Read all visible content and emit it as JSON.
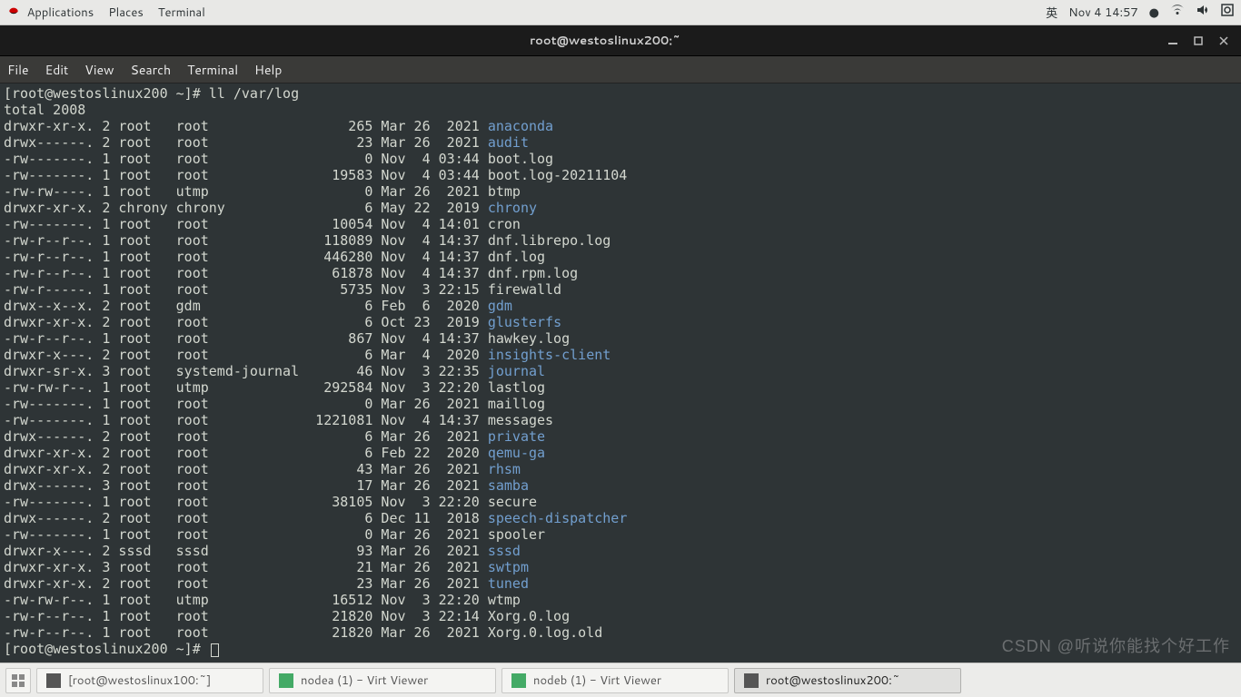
{
  "topbar": {
    "apps": "Applications",
    "places": "Places",
    "terminal": "Terminal",
    "lang": "英",
    "clock": "Nov 4  14:57",
    "dot": "●"
  },
  "window": {
    "title": "root@westoslinux200:~"
  },
  "menu": {
    "file": "File",
    "edit": "Edit",
    "view": "View",
    "search": "Search",
    "terminal": "Terminal",
    "help": "Help"
  },
  "prompt1": "[root@westoslinux200 ~]# ll /var/log",
  "total": "total 2008",
  "rows": [
    {
      "perm": "drwxr-xr-x.",
      "n": "2",
      "u": "root  ",
      "g": "root           ",
      "sz": "     265",
      "dt": "Mar 26  2021",
      "name": "anaconda",
      "dir": true
    },
    {
      "perm": "drwx------.",
      "n": "2",
      "u": "root  ",
      "g": "root           ",
      "sz": "      23",
      "dt": "Mar 26  2021",
      "name": "audit",
      "dir": true
    },
    {
      "perm": "-rw-------.",
      "n": "1",
      "u": "root  ",
      "g": "root           ",
      "sz": "       0",
      "dt": "Nov  4 03:44",
      "name": "boot.log",
      "dir": false
    },
    {
      "perm": "-rw-------.",
      "n": "1",
      "u": "root  ",
      "g": "root           ",
      "sz": "   19583",
      "dt": "Nov  4 03:44",
      "name": "boot.log-20211104",
      "dir": false
    },
    {
      "perm": "-rw-rw----.",
      "n": "1",
      "u": "root  ",
      "g": "utmp           ",
      "sz": "       0",
      "dt": "Mar 26  2021",
      "name": "btmp",
      "dir": false
    },
    {
      "perm": "drwxr-xr-x.",
      "n": "2",
      "u": "chrony",
      "g": "chrony         ",
      "sz": "       6",
      "dt": "May 22  2019",
      "name": "chrony",
      "dir": true
    },
    {
      "perm": "-rw-------.",
      "n": "1",
      "u": "root  ",
      "g": "root           ",
      "sz": "   10054",
      "dt": "Nov  4 14:01",
      "name": "cron",
      "dir": false
    },
    {
      "perm": "-rw-r--r--.",
      "n": "1",
      "u": "root  ",
      "g": "root           ",
      "sz": "  118089",
      "dt": "Nov  4 14:37",
      "name": "dnf.librepo.log",
      "dir": false
    },
    {
      "perm": "-rw-r--r--.",
      "n": "1",
      "u": "root  ",
      "g": "root           ",
      "sz": "  446280",
      "dt": "Nov  4 14:37",
      "name": "dnf.log",
      "dir": false
    },
    {
      "perm": "-rw-r--r--.",
      "n": "1",
      "u": "root  ",
      "g": "root           ",
      "sz": "   61878",
      "dt": "Nov  4 14:37",
      "name": "dnf.rpm.log",
      "dir": false
    },
    {
      "perm": "-rw-r-----.",
      "n": "1",
      "u": "root  ",
      "g": "root           ",
      "sz": "    5735",
      "dt": "Nov  3 22:15",
      "name": "firewalld",
      "dir": false
    },
    {
      "perm": "drwx--x--x.",
      "n": "2",
      "u": "root  ",
      "g": "gdm            ",
      "sz": "       6",
      "dt": "Feb  6  2020",
      "name": "gdm",
      "dir": true
    },
    {
      "perm": "drwxr-xr-x.",
      "n": "2",
      "u": "root  ",
      "g": "root           ",
      "sz": "       6",
      "dt": "Oct 23  2019",
      "name": "glusterfs",
      "dir": true
    },
    {
      "perm": "-rw-r--r--.",
      "n": "1",
      "u": "root  ",
      "g": "root           ",
      "sz": "     867",
      "dt": "Nov  4 14:37",
      "name": "hawkey.log",
      "dir": false
    },
    {
      "perm": "drwxr-x---.",
      "n": "2",
      "u": "root  ",
      "g": "root           ",
      "sz": "       6",
      "dt": "Mar  4  2020",
      "name": "insights-client",
      "dir": true
    },
    {
      "perm": "drwxr-sr-x.",
      "n": "3",
      "u": "root  ",
      "g": "systemd-journal",
      "sz": "      46",
      "dt": "Nov  3 22:35",
      "name": "journal",
      "dir": true
    },
    {
      "perm": "-rw-rw-r--.",
      "n": "1",
      "u": "root  ",
      "g": "utmp           ",
      "sz": "  292584",
      "dt": "Nov  3 22:20",
      "name": "lastlog",
      "dir": false
    },
    {
      "perm": "-rw-------.",
      "n": "1",
      "u": "root  ",
      "g": "root           ",
      "sz": "       0",
      "dt": "Mar 26  2021",
      "name": "maillog",
      "dir": false
    },
    {
      "perm": "-rw-------.",
      "n": "1",
      "u": "root  ",
      "g": "root           ",
      "sz": " 1221081",
      "dt": "Nov  4 14:37",
      "name": "messages",
      "dir": false
    },
    {
      "perm": "drwx------.",
      "n": "2",
      "u": "root  ",
      "g": "root           ",
      "sz": "       6",
      "dt": "Mar 26  2021",
      "name": "private",
      "dir": true
    },
    {
      "perm": "drwxr-xr-x.",
      "n": "2",
      "u": "root  ",
      "g": "root           ",
      "sz": "       6",
      "dt": "Feb 22  2020",
      "name": "qemu-ga",
      "dir": true
    },
    {
      "perm": "drwxr-xr-x.",
      "n": "2",
      "u": "root  ",
      "g": "root           ",
      "sz": "      43",
      "dt": "Mar 26  2021",
      "name": "rhsm",
      "dir": true
    },
    {
      "perm": "drwx------.",
      "n": "3",
      "u": "root  ",
      "g": "root           ",
      "sz": "      17",
      "dt": "Mar 26  2021",
      "name": "samba",
      "dir": true
    },
    {
      "perm": "-rw-------.",
      "n": "1",
      "u": "root  ",
      "g": "root           ",
      "sz": "   38105",
      "dt": "Nov  3 22:20",
      "name": "secure",
      "dir": false
    },
    {
      "perm": "drwx------.",
      "n": "2",
      "u": "root  ",
      "g": "root           ",
      "sz": "       6",
      "dt": "Dec 11  2018",
      "name": "speech-dispatcher",
      "dir": true
    },
    {
      "perm": "-rw-------.",
      "n": "1",
      "u": "root  ",
      "g": "root           ",
      "sz": "       0",
      "dt": "Mar 26  2021",
      "name": "spooler",
      "dir": false
    },
    {
      "perm": "drwxr-x---.",
      "n": "2",
      "u": "sssd  ",
      "g": "sssd           ",
      "sz": "      93",
      "dt": "Mar 26  2021",
      "name": "sssd",
      "dir": true
    },
    {
      "perm": "drwxr-xr-x.",
      "n": "3",
      "u": "root  ",
      "g": "root           ",
      "sz": "      21",
      "dt": "Mar 26  2021",
      "name": "swtpm",
      "dir": true
    },
    {
      "perm": "drwxr-xr-x.",
      "n": "2",
      "u": "root  ",
      "g": "root           ",
      "sz": "      23",
      "dt": "Mar 26  2021",
      "name": "tuned",
      "dir": true
    },
    {
      "perm": "-rw-rw-r--.",
      "n": "1",
      "u": "root  ",
      "g": "utmp           ",
      "sz": "   16512",
      "dt": "Nov  3 22:20",
      "name": "wtmp",
      "dir": false
    },
    {
      "perm": "-rw-r--r--.",
      "n": "1",
      "u": "root  ",
      "g": "root           ",
      "sz": "   21820",
      "dt": "Nov  3 22:14",
      "name": "Xorg.0.log",
      "dir": false
    },
    {
      "perm": "-rw-r--r--.",
      "n": "1",
      "u": "root  ",
      "g": "root           ",
      "sz": "   21820",
      "dt": "Mar 26  2021",
      "name": "Xorg.0.log.old",
      "dir": false
    }
  ],
  "prompt2": "[root@westoslinux200 ~]# ",
  "taskbar": {
    "t1": "[root@westoslinux100:~]",
    "t2": "nodea (1) - Virt Viewer",
    "t3": "nodeb (1) - Virt Viewer",
    "t4": "root@westoslinux200:~"
  },
  "watermark": "CSDN @听说你能找个好工作"
}
